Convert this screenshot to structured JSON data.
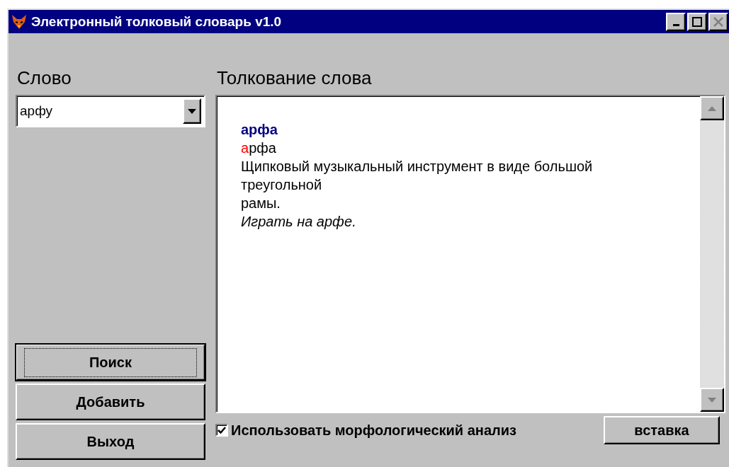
{
  "window": {
    "title": "Электронный толковый словарь v1.0",
    "close_disabled": true
  },
  "word_panel": {
    "heading": "Слово",
    "combo_value": "арфу"
  },
  "buttons": [
    {
      "label": "Поиск",
      "default": true
    },
    {
      "label": "Добавить",
      "default": false
    },
    {
      "label": "Выход",
      "default": false
    }
  ],
  "definition_panel": {
    "heading": "Толкование слова",
    "headword": "арфа",
    "stress_word": {
      "stressed": "а",
      "rest": "рфа"
    },
    "lines": [
      "Щипковый музыкальный инструмент в виде большой",
      "треугольной",
      "рамы."
    ],
    "example": "Играть на арфе."
  },
  "morphology_checkbox": {
    "label": "Использовать морфологический анализ",
    "checked": true
  },
  "insert_button": {
    "label": "вставка"
  }
}
